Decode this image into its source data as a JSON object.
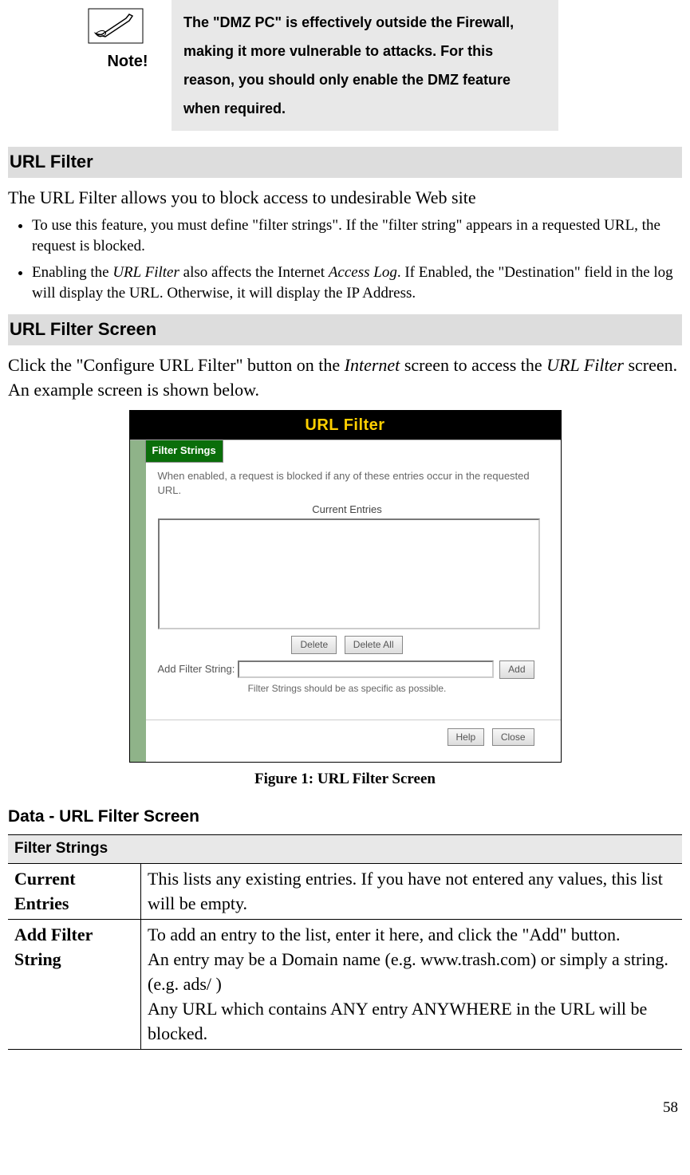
{
  "note": {
    "label": "Note!",
    "text": "The \"DMZ PC\" is effectively outside the Firewall, making it more vulnerable to attacks. For this reason, you should only enable the DMZ feature when required."
  },
  "sections": {
    "url_filter_title": "URL Filter",
    "url_filter_intro": "The URL Filter allows you to block access to undesirable Web site",
    "bullets": [
      "To use this feature, you must define \"filter strings\". If the \"filter string\" appears in a requested URL, the request is blocked.",
      "Enabling the URL Filter also affects the Internet Access Log. If Enabled, the \"Destination\" field in the log will display the URL. Otherwise, it will display the IP Address."
    ],
    "screen_title": "URL Filter Screen",
    "screen_intro_1": "Click the \"Configure URL Filter\" button on the ",
    "screen_intro_internet": "Internet",
    "screen_intro_2": " screen to access the ",
    "screen_intro_url": "URL Filter",
    "screen_intro_3": " screen. An example screen is shown below."
  },
  "figure": {
    "title": "URL Filter",
    "tab": "Filter Strings",
    "desc": "When enabled, a request is blocked if any of these entries occur in the requested URL.",
    "entries_label": "Current Entries",
    "delete": "Delete",
    "delete_all": "Delete All",
    "add_label": "Add Filter String:",
    "add_btn": "Add",
    "hint": "Filter Strings should be as specific as possible.",
    "help": "Help",
    "close": "Close",
    "caption": "Figure 1: URL Filter Screen"
  },
  "data_table": {
    "title": "Data - URL Filter Screen",
    "head": "Filter Strings",
    "rows": [
      {
        "label": "Current Entries",
        "desc": "This lists any existing entries. If you have not entered any values, this list will be empty."
      },
      {
        "label": "Add Filter String",
        "desc": "To add an entry to the list, enter it here, and click the \"Add\" button.\nAn entry may be a Domain name (e.g. www.trash.com) or simply a string. (e.g. ads/ )\nAny URL which contains ANY entry ANYWHERE in the URL will be blocked."
      }
    ]
  },
  "page_num": "58"
}
